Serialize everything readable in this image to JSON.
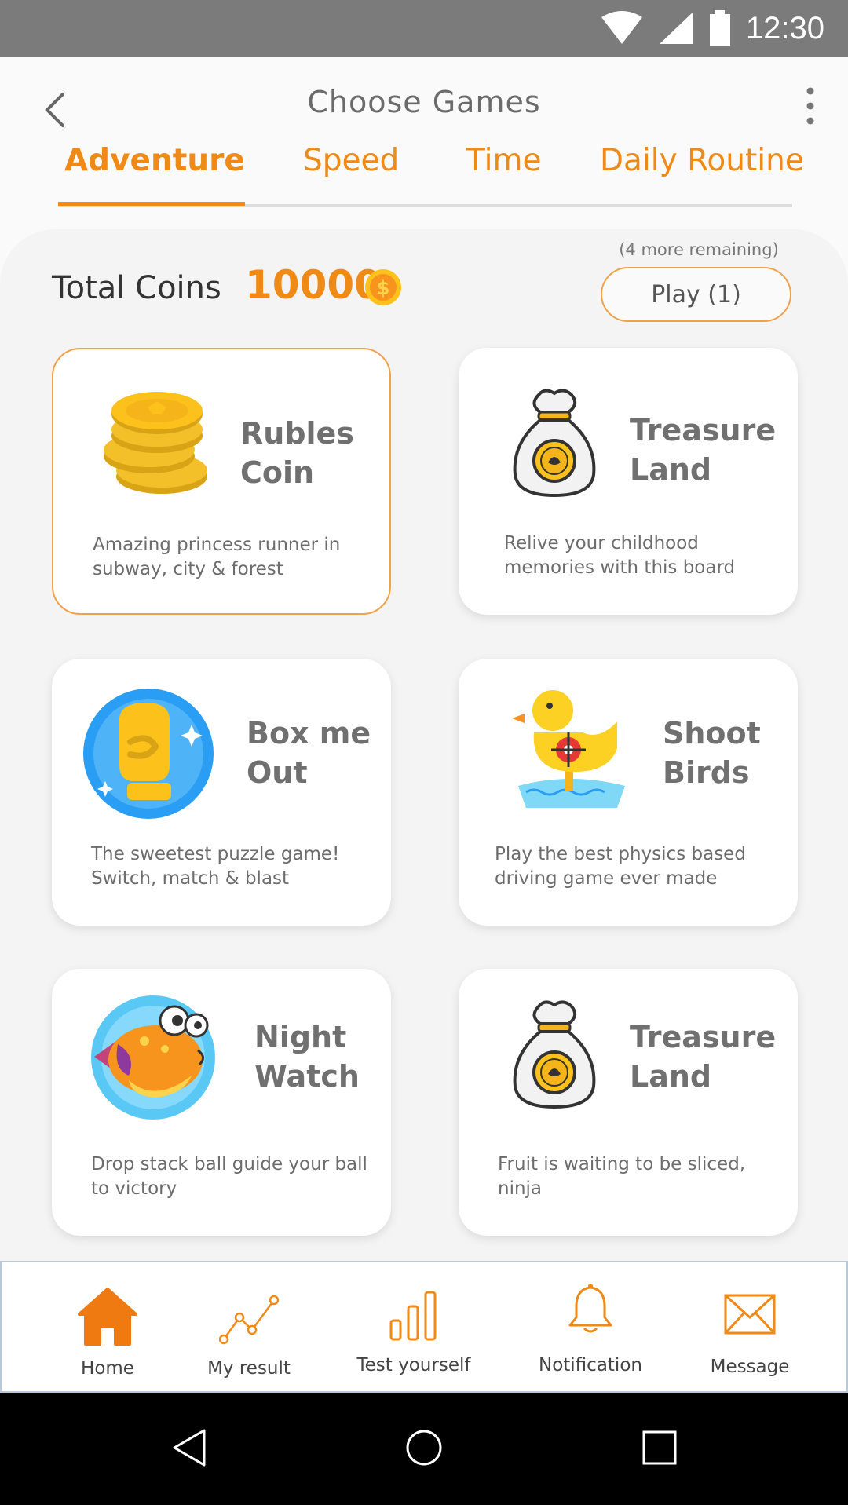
{
  "status_bar": {
    "time": "12:30"
  },
  "header": {
    "title": "Choose Games"
  },
  "tabs": [
    {
      "label": "Adventure",
      "active": true
    },
    {
      "label": "Speed",
      "active": false
    },
    {
      "label": "Time",
      "active": false
    },
    {
      "label": "Daily Routine",
      "active": false
    }
  ],
  "coins": {
    "label": "Total Coins",
    "value": "10000",
    "remaining": "(4 more remaining)",
    "play_label": "Play (1)"
  },
  "games": [
    {
      "title": "Rubles\nCoin",
      "description": "Amazing princess runner in subway, city & forest",
      "icon": "coin-stack-icon",
      "selected": true
    },
    {
      "title": "Treasure\nLand",
      "description": "Relive your childhood memories with this board",
      "icon": "money-bag-icon",
      "selected": false
    },
    {
      "title": "Box me\nOut",
      "description": "The sweetest puzzle game! Switch, match & blast",
      "icon": "boxing-glove-icon",
      "selected": false
    },
    {
      "title": "Shoot\nBirds",
      "description": "Play the best physics based driving game ever made",
      "icon": "duck-target-icon",
      "selected": false
    },
    {
      "title": "Night\nWatch",
      "description": "Drop stack ball guide your ball to victory",
      "icon": "fish-icon",
      "selected": false
    },
    {
      "title": "Treasure\nLand",
      "description": "Fruit is waiting to be sliced, ninja",
      "icon": "money-bag-icon",
      "selected": false
    }
  ],
  "bottom_nav": [
    {
      "label": "Home",
      "icon": "home-icon",
      "active": true
    },
    {
      "label": "My result",
      "icon": "chart-line-icon",
      "active": false
    },
    {
      "label": "Test yourself",
      "icon": "bar-chart-icon",
      "active": false
    },
    {
      "label": "Notification",
      "icon": "bell-icon",
      "active": false
    },
    {
      "label": "Message",
      "icon": "envelope-icon",
      "active": false
    }
  ],
  "colors": {
    "accent": "#f08a17",
    "text_gray": "#707070",
    "status_bar": "#7b7b7b"
  }
}
